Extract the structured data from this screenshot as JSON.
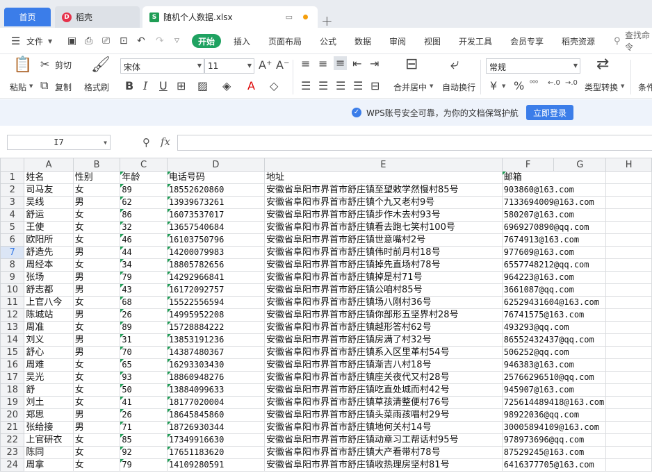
{
  "tabs": {
    "home": "首页",
    "docer": "稻壳",
    "docer_logo": "D",
    "file": "随机个人数据.xlsx",
    "file_logo": "S",
    "add": "+"
  },
  "menu": {
    "file": "文件",
    "items": [
      "开始",
      "插入",
      "页面布局",
      "公式",
      "数据",
      "审阅",
      "视图",
      "开发工具",
      "会员专享",
      "稻壳资源"
    ],
    "search": "查找命令"
  },
  "ribbon": {
    "paste": "粘贴",
    "cut": "剪切",
    "copy": "复制",
    "format_painter": "格式刷",
    "font_name": "宋体",
    "font_size": "11",
    "merge_center": "合并居中",
    "auto_wrap": "自动换行",
    "number_format": "常规",
    "type_convert": "类型转换",
    "conditional": "条件",
    "currency": "¥",
    "percent": "%"
  },
  "notice": {
    "text": "WPS账号安全可靠，为你的文档保驾护航",
    "login": "立即登录"
  },
  "formula_bar": {
    "cell_ref": "I7",
    "fx": "fx"
  },
  "sheet": {
    "columns": [
      "A",
      "B",
      "C",
      "D",
      "E",
      "F",
      "G",
      "H"
    ],
    "rows": [
      [
        "姓名",
        "性别",
        "年龄",
        "电话号码",
        "地址",
        "邮箱"
      ],
      [
        "司马友",
        "女",
        "89",
        "18552620860",
        "安徽省阜阳市界首市舒庄镇至望敕学然慢村85号",
        "903860@163.com"
      ],
      [
        "吴线",
        "男",
        "62",
        "13939673261",
        "安徽省阜阳市界首市舒庄镇个九又老村9号",
        "7133694009@163.com"
      ],
      [
        "舒运",
        "女",
        "86",
        "16073537017",
        "安徽省阜阳市界首市舒庄镇步作木去村93号",
        "580207@163.com"
      ],
      [
        "王使",
        "女",
        "32",
        "13657540684",
        "安徽省阜阳市界首市舒庄镇看去跑七笑村100号",
        "6969270890@qq.com"
      ],
      [
        "欧阳所",
        "女",
        "46",
        "16103750796",
        "安徽省阜阳市界首市舒庄镇世意嘴村2号",
        "7674913@163.com"
      ],
      [
        "舒造先",
        "男",
        "44",
        "14200079983",
        "安徽省阜阳市界首市舒庄镇伟时前月村18号",
        "977609@163.com"
      ],
      [
        "周经本",
        "女",
        "34",
        "18805782656",
        "安徽省阜阳市界首市舒庄镇掉先直场村78号",
        "6557748212@qq.com"
      ],
      [
        "张场",
        "男",
        "79",
        "14292966841",
        "安徽省阜阳市界首市舒庄镇掉是村71号",
        "964223@163.com"
      ],
      [
        "舒志都",
        "男",
        "43",
        "16172092757",
        "安徽省阜阳市界首市舒庄镇公咱村85号",
        "3661087@qq.com"
      ],
      [
        "上官八今",
        "女",
        "68",
        "15522556594",
        "安徽省阜阳市界首市舒庄镇场八刚村36号",
        "62529431604@163.com"
      ],
      [
        "陈城站",
        "男",
        "26",
        "14995952208",
        "安徽省阜阳市界首市舒庄镇你部形五坚界村28号",
        "76741575@163.com"
      ],
      [
        "周准",
        "女",
        "89",
        "15728884222",
        "安徽省阜阳市界首市舒庄镇越形答村62号",
        "493293@qq.com"
      ],
      [
        "刘义",
        "男",
        "31",
        "13853191236",
        "安徽省阜阳市界首市舒庄镇房满了村32号",
        "86552432437@qq.com"
      ],
      [
        "舒心",
        "男",
        "70",
        "14387480367",
        "安徽省阜阳市界首市舒庄镇系入区里革村54号",
        "506252@qq.com"
      ],
      [
        "周难",
        "女",
        "65",
        "16293303430",
        "安徽省阜阳市界首市舒庄镇渐吉八村18号",
        "946383@163.com"
      ],
      [
        "吴光",
        "女",
        "93",
        "18860948276",
        "安徽省阜阳市界首市舒庄镇座关夜代又村28号",
        "25766296510@qq.com"
      ],
      [
        "舒",
        "女",
        "50",
        "13884099633",
        "安徽省阜阳市界首市舒庄镇吃直处城而村42号",
        "945907@163.com"
      ],
      [
        "刘土",
        "女",
        "41",
        "18177020004",
        "安徽省阜阳市界首市舒庄镇草孩清整便村76号",
        "725614489418@163.com"
      ],
      [
        "郑思",
        "男",
        "26",
        "18645845860",
        "安徽省阜阳市界首市舒庄镇头菜雨孩唱村29号",
        "98922036@qq.com"
      ],
      [
        "张给接",
        "男",
        "71",
        "18726930344",
        "安徽省阜阳市界首市舒庄镇地何关村14号",
        "30005894109@163.com"
      ],
      [
        "上官研衣",
        "女",
        "85",
        "17349916630",
        "安徽省阜阳市界首市舒庄镇动章习工帮话村95号",
        "978973696@qq.com"
      ],
      [
        "陈同",
        "女",
        "92",
        "17651183620",
        "安徽省阜阳市界首市舒庄镇大产看带村78号",
        "87529245@163.com"
      ],
      [
        "周拿",
        "女",
        "79",
        "14109280591",
        "安徽省阜阳市界首市舒庄镇收热理房坚村81号",
        "6416377705@163.com"
      ]
    ]
  }
}
